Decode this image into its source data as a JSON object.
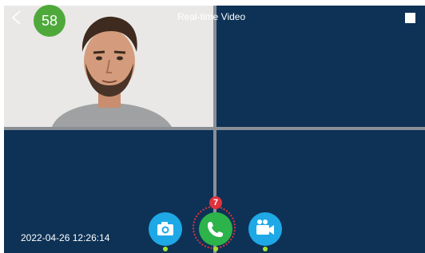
{
  "header": {
    "back_icon": "chevron-left-icon",
    "countdown": "58",
    "title": "Real-time Video",
    "fullscreen_icon": "square-icon"
  },
  "status": {
    "timestamp": "2022-04-26 12:26:14"
  },
  "actions": {
    "snapshot_icon": "camera-icon",
    "answer_icon": "phone-icon",
    "record_icon": "video-camera-icon",
    "missed_calls": "7"
  },
  "colors": {
    "background": "#0d3256",
    "grid": "#8a8f96",
    "countdown": "#4fa93a",
    "answer": "#2cb34a",
    "secondary_action": "#1fa8e6",
    "alert": "#e0323b"
  }
}
